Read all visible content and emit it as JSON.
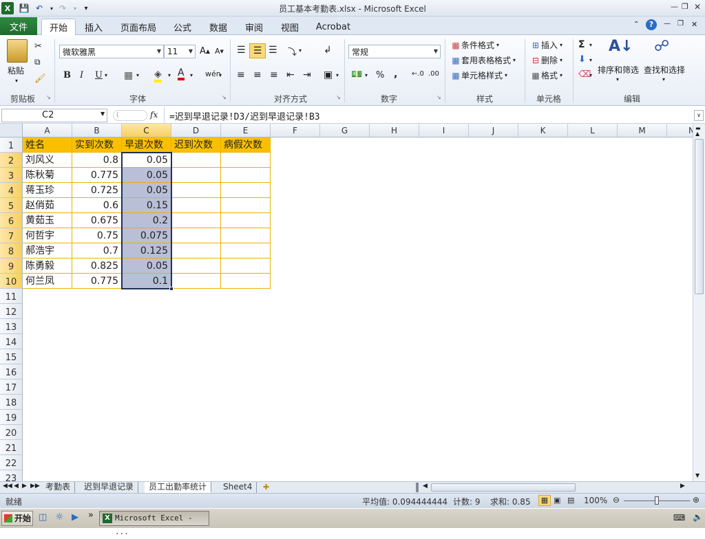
{
  "window": {
    "title": "员工基本考勤表.xlsx - Microsoft Excel"
  },
  "ribbon_tabs": [
    {
      "label": "文件"
    },
    {
      "label": "开始"
    },
    {
      "label": "插入"
    },
    {
      "label": "页面布局"
    },
    {
      "label": "公式"
    },
    {
      "label": "数据"
    },
    {
      "label": "审阅"
    },
    {
      "label": "视图"
    },
    {
      "label": "Acrobat"
    }
  ],
  "ribbon": {
    "clipboard": {
      "paste": "粘贴",
      "group": "剪贴板"
    },
    "font": {
      "name": "微软雅黑",
      "size": "11",
      "group": "字体"
    },
    "alignment": {
      "group": "对齐方式"
    },
    "number": {
      "format": "常规",
      "group": "数字"
    },
    "styles": {
      "conditional": "条件格式",
      "table": "套用表格格式",
      "cell": "单元格样式",
      "group": "样式"
    },
    "cells": {
      "insert": "插入",
      "delete": "删除",
      "format": "格式",
      "group": "单元格"
    },
    "editing": {
      "sort": "排序和筛选",
      "find": "查找和选择",
      "group": "编辑"
    }
  },
  "formula_bar": {
    "cell_ref": "C2",
    "fx": "fx",
    "formula": "=迟到早退记录!D3/迟到早退记录!B3"
  },
  "columns": [
    "A",
    "B",
    "C",
    "D",
    "E",
    "F",
    "G",
    "H",
    "I",
    "J",
    "K",
    "L",
    "M",
    "N"
  ],
  "rows": [
    "1",
    "2",
    "3",
    "4",
    "5",
    "6",
    "7",
    "8",
    "9",
    "10",
    "11",
    "12",
    "13",
    "14",
    "15",
    "16",
    "17",
    "18",
    "19",
    "20",
    "21",
    "22",
    "23"
  ],
  "table": {
    "headers": [
      "姓名",
      "实到次数",
      "早退次数",
      "迟到次数",
      "病假次数"
    ],
    "rows": [
      [
        "刘风义",
        "0.8",
        "0.05",
        "",
        ""
      ],
      [
        "陈秋菊",
        "0.775",
        "0.05",
        "",
        ""
      ],
      [
        "蒋玉珍",
        "0.725",
        "0.05",
        "",
        ""
      ],
      [
        "赵俏茹",
        "0.6",
        "0.15",
        "",
        ""
      ],
      [
        "黄茹玉",
        "0.675",
        "0.2",
        "",
        ""
      ],
      [
        "何哲宇",
        "0.75",
        "0.075",
        "",
        ""
      ],
      [
        "郝浩宇",
        "0.7",
        "0.125",
        "",
        ""
      ],
      [
        "陈勇毅",
        "0.825",
        "0.05",
        "",
        ""
      ],
      [
        "何兰凤",
        "0.775",
        "0.1",
        "",
        ""
      ]
    ]
  },
  "sheets": [
    {
      "label": "考勤表"
    },
    {
      "label": "迟到早退记录"
    },
    {
      "label": "员工出勤率统计"
    },
    {
      "label": "Sheet4"
    }
  ],
  "status": {
    "ready": "就绪",
    "average": "平均值: 0.094444444",
    "count": "计数: 9",
    "sum": "求和: 0.85",
    "zoom": "100%"
  },
  "taskbar": {
    "start": "开始",
    "task": "Microsoft Excel - ..."
  },
  "colors": {
    "header_fill": "#fac000",
    "selection": "#b8bfd6",
    "excel_green": "#1e6b2d"
  }
}
